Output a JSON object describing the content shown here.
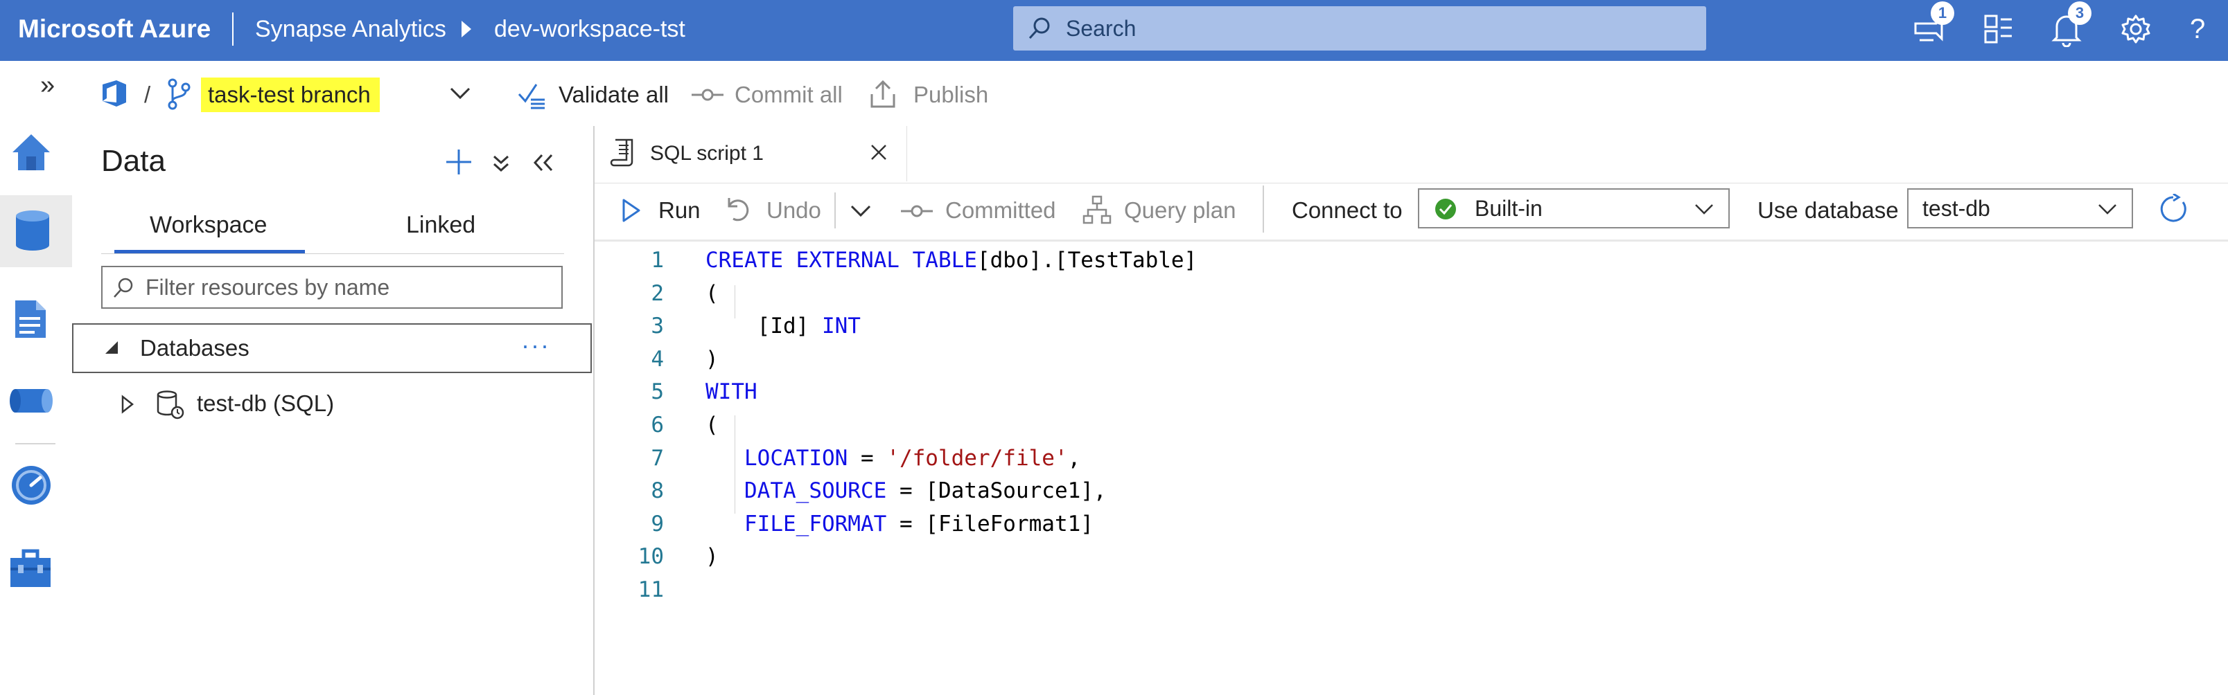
{
  "topbar": {
    "brand": "Microsoft Azure",
    "breadcrumb": [
      "Synapse Analytics",
      "dev-workspace-tst"
    ],
    "search_placeholder": "Search",
    "notification_badge_1": "1",
    "notification_badge_2": "3",
    "help": "?"
  },
  "toolbar2": {
    "expand": "»",
    "separator": "/",
    "branch": "task-test branch",
    "validate_all": "Validate all",
    "commit_all": "Commit all",
    "publish": "Publish"
  },
  "data_panel": {
    "title": "Data",
    "tabs": [
      "Workspace",
      "Linked"
    ],
    "active_tab": "Workspace",
    "filter_placeholder": "Filter resources by name",
    "section": "Databases",
    "section_more": "···",
    "items": [
      {
        "label": "test-db (SQL)"
      }
    ]
  },
  "editor": {
    "tab_title": "SQL script 1",
    "run": "Run",
    "undo": "Undo",
    "committed": "Committed",
    "query_plan": "Query plan",
    "connect_to_label": "Connect to",
    "connect_to_value": "Built-in",
    "use_database_label": "Use database",
    "use_database_value": "test-db"
  },
  "code_lines": [
    {
      "n": "1",
      "parts": [
        [
          "kw",
          "CREATE EXTERNAL TABLE"
        ],
        [
          "",
          "[dbo].[TestTable]"
        ]
      ]
    },
    {
      "n": "2",
      "parts": [
        [
          "",
          "("
        ]
      ]
    },
    {
      "n": "3",
      "parts": [
        [
          "",
          "    [Id] "
        ],
        [
          "kw",
          "INT"
        ]
      ]
    },
    {
      "n": "4",
      "parts": [
        [
          "",
          ")"
        ]
      ]
    },
    {
      "n": "5",
      "parts": [
        [
          "kw",
          "WITH"
        ]
      ]
    },
    {
      "n": "6",
      "parts": [
        [
          "",
          "("
        ]
      ]
    },
    {
      "n": "7",
      "parts": [
        [
          "",
          "   "
        ],
        [
          "kw",
          "LOCATION"
        ],
        [
          "",
          " = "
        ],
        [
          "str",
          "'/folder/file'"
        ],
        [
          "",
          ","
        ]
      ]
    },
    {
      "n": "8",
      "parts": [
        [
          "",
          "   "
        ],
        [
          "kw",
          "DATA_SOURCE"
        ],
        [
          "",
          " = [DataSource1],"
        ]
      ]
    },
    {
      "n": "9",
      "parts": [
        [
          "",
          "   "
        ],
        [
          "kw",
          "FILE_FORMAT"
        ],
        [
          "",
          " = [FileFormat1]"
        ]
      ]
    },
    {
      "n": "10",
      "parts": [
        [
          "",
          ")"
        ]
      ]
    },
    {
      "n": "11",
      "parts": []
    }
  ],
  "colors": {
    "topbar": "#3f72c7",
    "accent": "#2b63c9",
    "branch_highlight": "#ffff3c",
    "keyword": "#1010e6",
    "string": "#a31515",
    "line_number": "#237893",
    "success": "#3a9a2e"
  }
}
